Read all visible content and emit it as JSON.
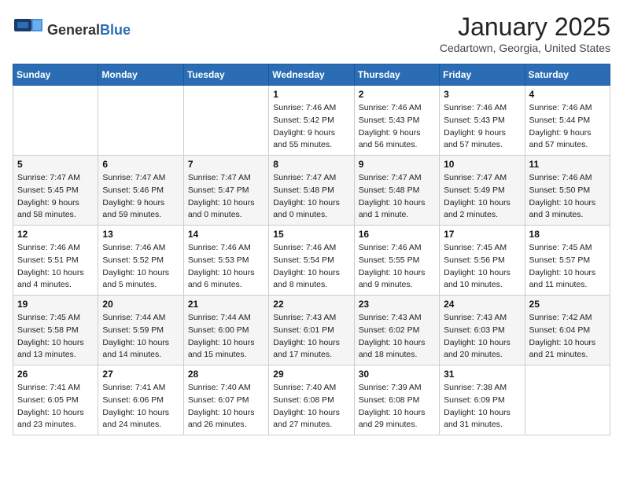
{
  "logo": {
    "general": "General",
    "blue": "Blue"
  },
  "title": {
    "month": "January 2025",
    "location": "Cedartown, Georgia, United States"
  },
  "headers": [
    "Sunday",
    "Monday",
    "Tuesday",
    "Wednesday",
    "Thursday",
    "Friday",
    "Saturday"
  ],
  "weeks": [
    [
      {
        "day": "",
        "sunrise": "",
        "sunset": "",
        "daylight": ""
      },
      {
        "day": "",
        "sunrise": "",
        "sunset": "",
        "daylight": ""
      },
      {
        "day": "",
        "sunrise": "",
        "sunset": "",
        "daylight": ""
      },
      {
        "day": "1",
        "sunrise": "Sunrise: 7:46 AM",
        "sunset": "Sunset: 5:42 PM",
        "daylight": "Daylight: 9 hours and 55 minutes."
      },
      {
        "day": "2",
        "sunrise": "Sunrise: 7:46 AM",
        "sunset": "Sunset: 5:43 PM",
        "daylight": "Daylight: 9 hours and 56 minutes."
      },
      {
        "day": "3",
        "sunrise": "Sunrise: 7:46 AM",
        "sunset": "Sunset: 5:43 PM",
        "daylight": "Daylight: 9 hours and 57 minutes."
      },
      {
        "day": "4",
        "sunrise": "Sunrise: 7:46 AM",
        "sunset": "Sunset: 5:44 PM",
        "daylight": "Daylight: 9 hours and 57 minutes."
      }
    ],
    [
      {
        "day": "5",
        "sunrise": "Sunrise: 7:47 AM",
        "sunset": "Sunset: 5:45 PM",
        "daylight": "Daylight: 9 hours and 58 minutes."
      },
      {
        "day": "6",
        "sunrise": "Sunrise: 7:47 AM",
        "sunset": "Sunset: 5:46 PM",
        "daylight": "Daylight: 9 hours and 59 minutes."
      },
      {
        "day": "7",
        "sunrise": "Sunrise: 7:47 AM",
        "sunset": "Sunset: 5:47 PM",
        "daylight": "Daylight: 10 hours and 0 minutes."
      },
      {
        "day": "8",
        "sunrise": "Sunrise: 7:47 AM",
        "sunset": "Sunset: 5:48 PM",
        "daylight": "Daylight: 10 hours and 0 minutes."
      },
      {
        "day": "9",
        "sunrise": "Sunrise: 7:47 AM",
        "sunset": "Sunset: 5:48 PM",
        "daylight": "Daylight: 10 hours and 1 minute."
      },
      {
        "day": "10",
        "sunrise": "Sunrise: 7:47 AM",
        "sunset": "Sunset: 5:49 PM",
        "daylight": "Daylight: 10 hours and 2 minutes."
      },
      {
        "day": "11",
        "sunrise": "Sunrise: 7:46 AM",
        "sunset": "Sunset: 5:50 PM",
        "daylight": "Daylight: 10 hours and 3 minutes."
      }
    ],
    [
      {
        "day": "12",
        "sunrise": "Sunrise: 7:46 AM",
        "sunset": "Sunset: 5:51 PM",
        "daylight": "Daylight: 10 hours and 4 minutes."
      },
      {
        "day": "13",
        "sunrise": "Sunrise: 7:46 AM",
        "sunset": "Sunset: 5:52 PM",
        "daylight": "Daylight: 10 hours and 5 minutes."
      },
      {
        "day": "14",
        "sunrise": "Sunrise: 7:46 AM",
        "sunset": "Sunset: 5:53 PM",
        "daylight": "Daylight: 10 hours and 6 minutes."
      },
      {
        "day": "15",
        "sunrise": "Sunrise: 7:46 AM",
        "sunset": "Sunset: 5:54 PM",
        "daylight": "Daylight: 10 hours and 8 minutes."
      },
      {
        "day": "16",
        "sunrise": "Sunrise: 7:46 AM",
        "sunset": "Sunset: 5:55 PM",
        "daylight": "Daylight: 10 hours and 9 minutes."
      },
      {
        "day": "17",
        "sunrise": "Sunrise: 7:45 AM",
        "sunset": "Sunset: 5:56 PM",
        "daylight": "Daylight: 10 hours and 10 minutes."
      },
      {
        "day": "18",
        "sunrise": "Sunrise: 7:45 AM",
        "sunset": "Sunset: 5:57 PM",
        "daylight": "Daylight: 10 hours and 11 minutes."
      }
    ],
    [
      {
        "day": "19",
        "sunrise": "Sunrise: 7:45 AM",
        "sunset": "Sunset: 5:58 PM",
        "daylight": "Daylight: 10 hours and 13 minutes."
      },
      {
        "day": "20",
        "sunrise": "Sunrise: 7:44 AM",
        "sunset": "Sunset: 5:59 PM",
        "daylight": "Daylight: 10 hours and 14 minutes."
      },
      {
        "day": "21",
        "sunrise": "Sunrise: 7:44 AM",
        "sunset": "Sunset: 6:00 PM",
        "daylight": "Daylight: 10 hours and 15 minutes."
      },
      {
        "day": "22",
        "sunrise": "Sunrise: 7:43 AM",
        "sunset": "Sunset: 6:01 PM",
        "daylight": "Daylight: 10 hours and 17 minutes."
      },
      {
        "day": "23",
        "sunrise": "Sunrise: 7:43 AM",
        "sunset": "Sunset: 6:02 PM",
        "daylight": "Daylight: 10 hours and 18 minutes."
      },
      {
        "day": "24",
        "sunrise": "Sunrise: 7:43 AM",
        "sunset": "Sunset: 6:03 PM",
        "daylight": "Daylight: 10 hours and 20 minutes."
      },
      {
        "day": "25",
        "sunrise": "Sunrise: 7:42 AM",
        "sunset": "Sunset: 6:04 PM",
        "daylight": "Daylight: 10 hours and 21 minutes."
      }
    ],
    [
      {
        "day": "26",
        "sunrise": "Sunrise: 7:41 AM",
        "sunset": "Sunset: 6:05 PM",
        "daylight": "Daylight: 10 hours and 23 minutes."
      },
      {
        "day": "27",
        "sunrise": "Sunrise: 7:41 AM",
        "sunset": "Sunset: 6:06 PM",
        "daylight": "Daylight: 10 hours and 24 minutes."
      },
      {
        "day": "28",
        "sunrise": "Sunrise: 7:40 AM",
        "sunset": "Sunset: 6:07 PM",
        "daylight": "Daylight: 10 hours and 26 minutes."
      },
      {
        "day": "29",
        "sunrise": "Sunrise: 7:40 AM",
        "sunset": "Sunset: 6:08 PM",
        "daylight": "Daylight: 10 hours and 27 minutes."
      },
      {
        "day": "30",
        "sunrise": "Sunrise: 7:39 AM",
        "sunset": "Sunset: 6:08 PM",
        "daylight": "Daylight: 10 hours and 29 minutes."
      },
      {
        "day": "31",
        "sunrise": "Sunrise: 7:38 AM",
        "sunset": "Sunset: 6:09 PM",
        "daylight": "Daylight: 10 hours and 31 minutes."
      },
      {
        "day": "",
        "sunrise": "",
        "sunset": "",
        "daylight": ""
      }
    ]
  ]
}
